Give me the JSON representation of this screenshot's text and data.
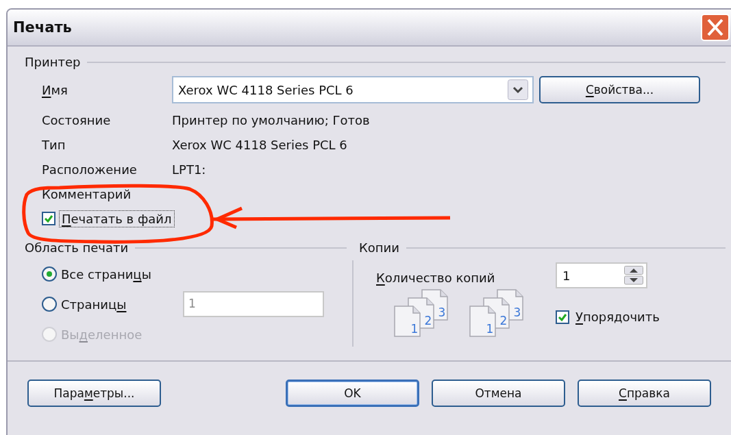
{
  "window": {
    "title": "Печать"
  },
  "printer": {
    "legend": "Принтер",
    "name_label": [
      {
        "text": "И",
        "underline": true
      },
      {
        "text": "мя",
        "underline": false
      }
    ],
    "name_value": "Xerox WC 4118 Series PCL 6",
    "properties_button": [
      {
        "text": "С",
        "underline": true
      },
      {
        "text": "войства...",
        "underline": false
      }
    ],
    "info": [
      {
        "label": "Состояние",
        "value": "Принтер по умолчанию; Готов"
      },
      {
        "label": "Тип",
        "value": "Xerox WC 4118 Series PCL 6"
      },
      {
        "label": "Расположение",
        "value": "LPT1:"
      },
      {
        "label": "Комментарий"
      }
    ],
    "print_to_file": {
      "label": [
        {
          "text": "П",
          "underline": true
        },
        {
          "text": "ечатать в файл",
          "underline": false
        }
      ],
      "checked": true,
      "focused": true
    }
  },
  "annotation": {
    "kind": "circle-arrow"
  },
  "print_range": {
    "legend": "Область печати",
    "options": [
      {
        "label": [
          {
            "text": "Все страни",
            "underline": false
          },
          {
            "text": "ц",
            "underline": true
          },
          {
            "text": "ы",
            "underline": false
          }
        ],
        "selected": true,
        "disabled": false
      },
      {
        "label": [
          {
            "text": "Страниц",
            "underline": false
          },
          {
            "text": "ы",
            "underline": true
          }
        ],
        "selected": false,
        "disabled": false
      },
      {
        "label": [
          {
            "text": "Вы",
            "underline": false
          },
          {
            "text": "д",
            "underline": true
          },
          {
            "text": "еленное",
            "underline": false
          }
        ],
        "selected": false,
        "disabled": true
      }
    ],
    "pages_field": {
      "value": "1",
      "disabled": true
    }
  },
  "copies": {
    "legend": "Копии",
    "count_label": [
      {
        "text": "К",
        "underline": true
      },
      {
        "text": "оличество копий",
        "underline": false
      }
    ],
    "count": "1",
    "collate_icons": [
      {
        "pages": [
          "1",
          "2",
          "3"
        ]
      },
      {
        "pages": [
          "1",
          "2",
          "3"
        ]
      }
    ],
    "collate": {
      "label": [
        {
          "text": "У",
          "underline": true
        },
        {
          "text": "порядочить",
          "underline": false
        }
      ],
      "checked": true
    }
  },
  "buttons": [
    {
      "label": [
        {
          "text": "Пара",
          "underline": false
        },
        {
          "text": "м",
          "underline": true
        },
        {
          "text": "етры...",
          "underline": false
        }
      ],
      "default": false
    },
    {
      "label": [
        {
          "text": "OK",
          "underline": false
        }
      ],
      "default": true
    },
    {
      "label": [
        {
          "text": "Отмена",
          "underline": false
        }
      ],
      "default": false
    },
    {
      "label": [
        {
          "text": "С",
          "underline": true
        },
        {
          "text": "правка",
          "underline": false
        }
      ],
      "default": false
    }
  ]
}
